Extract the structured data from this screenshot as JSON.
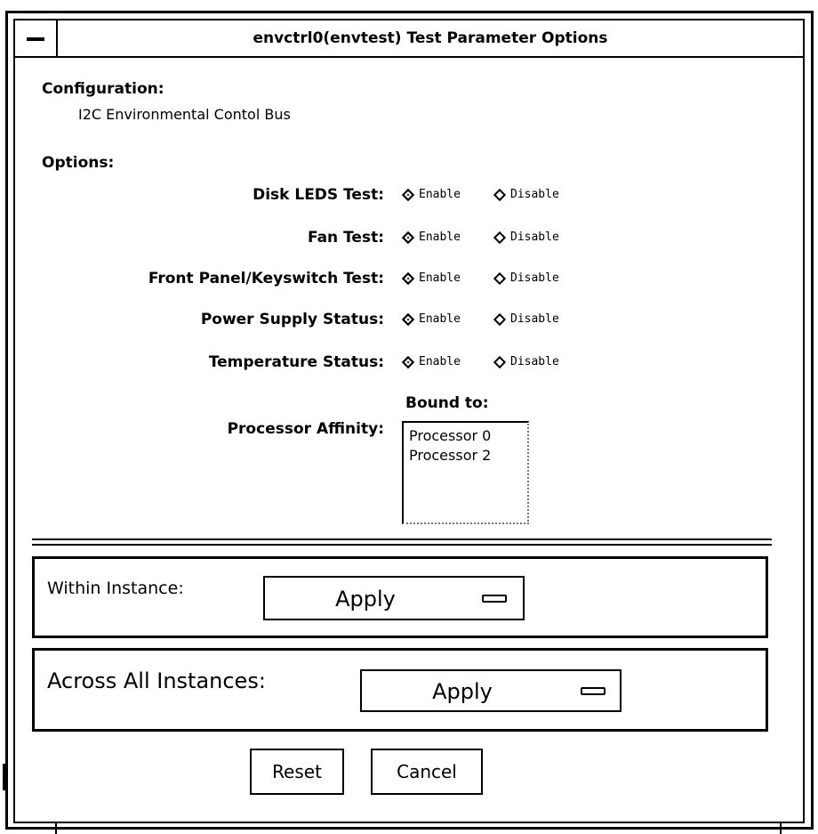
{
  "window": {
    "title": "envctrl0(envtest) Test Parameter Options"
  },
  "configuration": {
    "heading": "Configuration:",
    "value": "I2C Environmental Contol Bus"
  },
  "options": {
    "heading": "Options:",
    "enable_label": "Enable",
    "disable_label": "Disable",
    "tests": [
      {
        "label": "Disk LEDS Test:",
        "selected": "Enable"
      },
      {
        "label": "Fan Test:",
        "selected": "Enable"
      },
      {
        "label": "Front Panel/Keyswitch Test:",
        "selected": "Enable"
      },
      {
        "label": "Power Supply Status:",
        "selected": "Enable"
      },
      {
        "label": "Temperature Status:",
        "selected": "Enable"
      }
    ],
    "processor_affinity": {
      "label": "Processor Affinity:",
      "bound_to_label": "Bound to:",
      "processors": [
        "Processor 0",
        "Processor 2"
      ]
    }
  },
  "within_instance": {
    "label": "Within Instance:",
    "value": "Apply"
  },
  "across_instances": {
    "label": "Across All Instances:",
    "value": "Apply"
  },
  "buttons": {
    "reset": "Reset",
    "cancel": "Cancel"
  }
}
